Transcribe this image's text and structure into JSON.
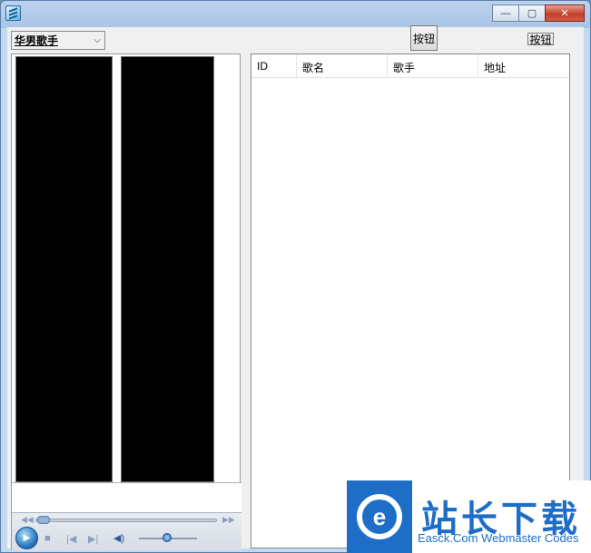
{
  "window": {
    "title": ""
  },
  "toolbar": {
    "category_select": "华男歌手",
    "button1_label": "按钮",
    "button2_label": "按钮"
  },
  "table": {
    "columns": [
      "ID",
      "歌名",
      "歌手",
      "地址"
    ],
    "rows": []
  },
  "player": {
    "play_symbol": "▶",
    "stop_symbol": "■",
    "prev_symbol": "|◀",
    "next_symbol": "▶|",
    "volume_symbol": "◀)",
    "rewind_symbol": "◀◀",
    "ff_symbol": "▶▶"
  },
  "watermark": {
    "logo_letter": "e",
    "title": "站长下载",
    "subtitle": "Easck.Com Webmaster Codes"
  }
}
